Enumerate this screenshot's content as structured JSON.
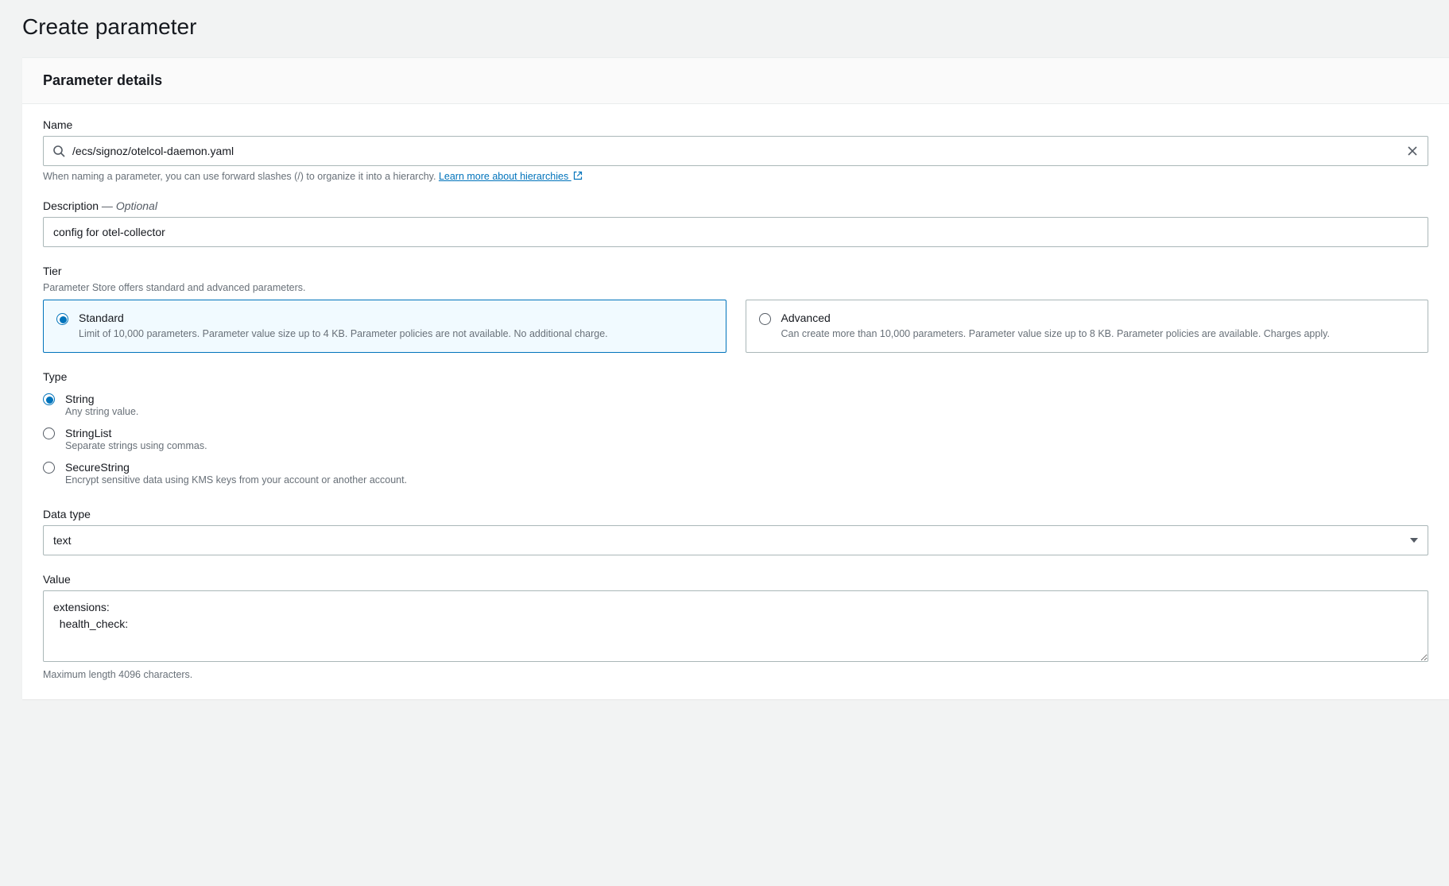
{
  "page": {
    "title": "Create parameter"
  },
  "panel": {
    "title": "Parameter details"
  },
  "name": {
    "label": "Name",
    "value": "/ecs/signoz/otelcol-daemon.yaml",
    "hint_prefix": "When naming a parameter, you can use forward slashes (/) to organize it into a hierarchy. ",
    "hint_link": "Learn more about hierarchies "
  },
  "description": {
    "label": "Description",
    "optional_suffix": "Optional",
    "value": "config for otel-collector"
  },
  "tier": {
    "label": "Tier",
    "sub": "Parameter Store offers standard and advanced parameters.",
    "options": [
      {
        "title": "Standard",
        "sub": "Limit of 10,000 parameters. Parameter value size up to 4 KB. Parameter policies are not available. No additional charge.",
        "selected": true
      },
      {
        "title": "Advanced",
        "sub": "Can create more than 10,000 parameters. Parameter value size up to 8 KB. Parameter policies are available. Charges apply.",
        "selected": false
      }
    ]
  },
  "type": {
    "label": "Type",
    "options": [
      {
        "title": "String",
        "sub": "Any string value.",
        "selected": true
      },
      {
        "title": "StringList",
        "sub": "Separate strings using commas.",
        "selected": false
      },
      {
        "title": "SecureString",
        "sub": "Encrypt sensitive data using KMS keys from your account or another account.",
        "selected": false
      }
    ]
  },
  "datatype": {
    "label": "Data type",
    "value": "text"
  },
  "value": {
    "label": "Value",
    "text": "extensions:\n  health_check:",
    "hint": "Maximum length 4096 characters."
  }
}
